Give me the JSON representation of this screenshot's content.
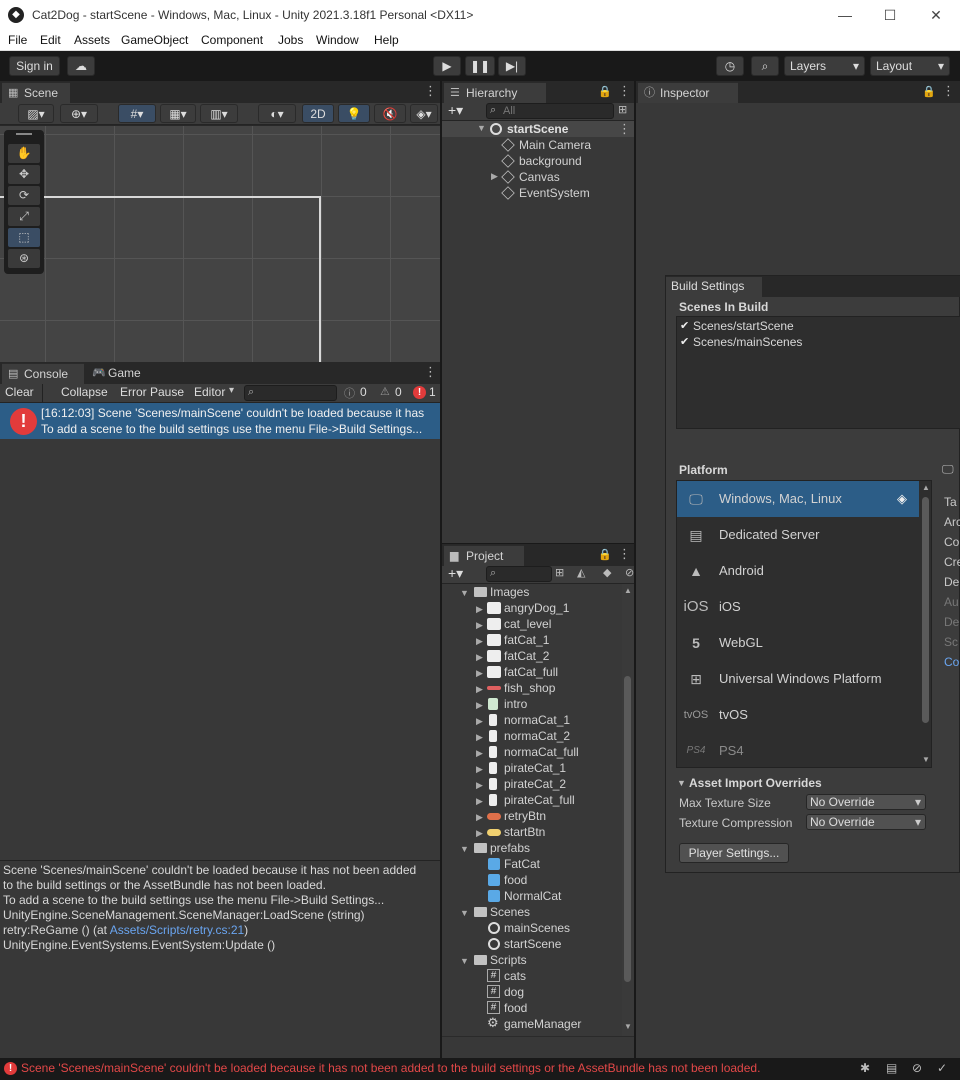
{
  "window": {
    "title": "Cat2Dog - startScene - Windows, Mac, Linux - Unity 2021.3.18f1 Personal <DX11>",
    "minimize": "—",
    "maximize": "☐",
    "close": "✕"
  },
  "menu": [
    "File",
    "Edit",
    "Assets",
    "GameObject",
    "Component",
    "Jobs",
    "Window",
    "Help"
  ],
  "toolbar": {
    "sign_in": "Sign in",
    "layers": "Layers",
    "layout": "Layout"
  },
  "scene": {
    "tab": "Scene",
    "mode_2d": "2D"
  },
  "console": {
    "tabs": [
      "Console",
      "Game"
    ],
    "clear": "Clear",
    "collapse": "Collapse",
    "error_pause": "Error Pause",
    "editor": "Editor",
    "count_log": "0",
    "count_warn": "0",
    "count_error": "1",
    "entry_line1": "[16:12:03] Scene 'Scenes/mainScene' couldn't be loaded because it has",
    "entry_line2": "To add a scene to the build settings use the menu File->Build Settings...",
    "detail": [
      "Scene 'Scenes/mainScene' couldn't be loaded because it has not been added",
      "to the build settings or the AssetBundle has not been loaded.",
      "To add a scene to the build settings use the menu File->Build Settings...",
      "UnityEngine.SceneManagement.SceneManager:LoadScene (string)"
    ],
    "detail_retry_pre": "retry:ReGame () (at ",
    "detail_retry_link": "Assets/Scripts/retry.cs:21",
    "detail_retry_post": ")",
    "detail_last": "UnityEngine.EventSystems.EventSystem:Update ()"
  },
  "hierarchy": {
    "tab": "Hierarchy",
    "search_placeholder": "All",
    "root": "startScene",
    "children": [
      "Main Camera",
      "background",
      "Canvas",
      "EventSystem"
    ]
  },
  "project": {
    "tab": "Project",
    "folders": [
      {
        "name": "Images",
        "items": [
          "angryDog_1",
          "cat_level",
          "fatCat_1",
          "fatCat_2",
          "fatCat_full",
          "fish_shop",
          "intro",
          "normaCat_1",
          "normaCat_2",
          "normaCat_full",
          "pirateCat_1",
          "pirateCat_2",
          "pirateCat_full",
          "retryBtn",
          "startBtn"
        ]
      },
      {
        "name": "prefabs",
        "items": [
          "FatCat",
          "food",
          "NormalCat"
        ]
      },
      {
        "name": "Scenes",
        "items": [
          "mainScenes",
          "startScene"
        ]
      },
      {
        "name": "Scripts",
        "items": [
          "cats",
          "dog",
          "food",
          "gameManager"
        ]
      }
    ]
  },
  "inspector": {
    "tab": "Inspector"
  },
  "build_settings": {
    "tab": "Build Settings",
    "scenes_header": "Scenes In Build",
    "scenes": [
      "Scenes/startScene",
      "Scenes/mainScenes"
    ],
    "platform_header": "Platform",
    "platforms": [
      "Windows, Mac, Linux",
      "Dedicated Server",
      "Android",
      "iOS",
      "WebGL",
      "Universal Windows Platform",
      "tvOS",
      "PS4"
    ],
    "platform_icons": [
      "🖵",
      "▤",
      "▲",
      "iOS",
      "5",
      "⊞",
      "tvOS",
      "PS4"
    ],
    "side_labels": [
      "Ta",
      "Arc",
      "Co",
      "Cre",
      "De",
      "Au",
      "De",
      "Sc",
      "Co"
    ],
    "asset_import": "Asset Import Overrides",
    "max_texture_label": "Max Texture Size",
    "max_texture_value": "No Override",
    "texture_comp_label": "Texture Compression",
    "texture_comp_value": "No Override",
    "player_settings": "Player Settings..."
  },
  "status": {
    "message": "Scene 'Scenes/mainScene' couldn't be loaded because it has not been added to the build settings or the AssetBundle has not been loaded."
  }
}
